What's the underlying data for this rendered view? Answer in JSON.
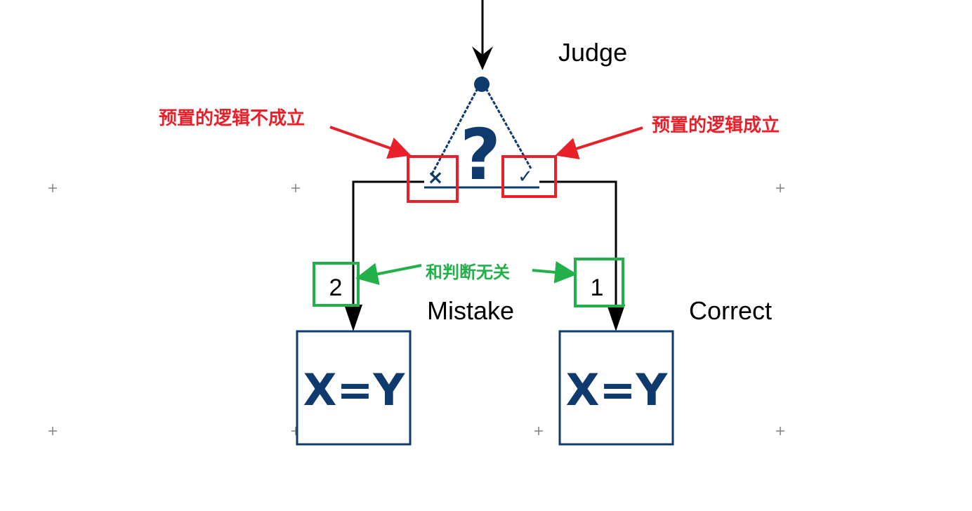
{
  "labels": {
    "judge": "Judge",
    "mistake": "Mistake",
    "correct": "Correct",
    "branch_false": "2",
    "branch_true": "1",
    "assign_left": "X=Y",
    "assign_right": "X=Y",
    "decision_symbol": "?"
  },
  "annotations": {
    "false_note": "预置的逻辑不成立",
    "true_note": "预置的逻辑成立",
    "order_note": "和判断无关"
  },
  "colors": {
    "block": "#0e3a6e",
    "annotation_red": "#e8202a",
    "annotation_green": "#22b04b",
    "wire": "#000000",
    "grid_marker": "#808080"
  }
}
